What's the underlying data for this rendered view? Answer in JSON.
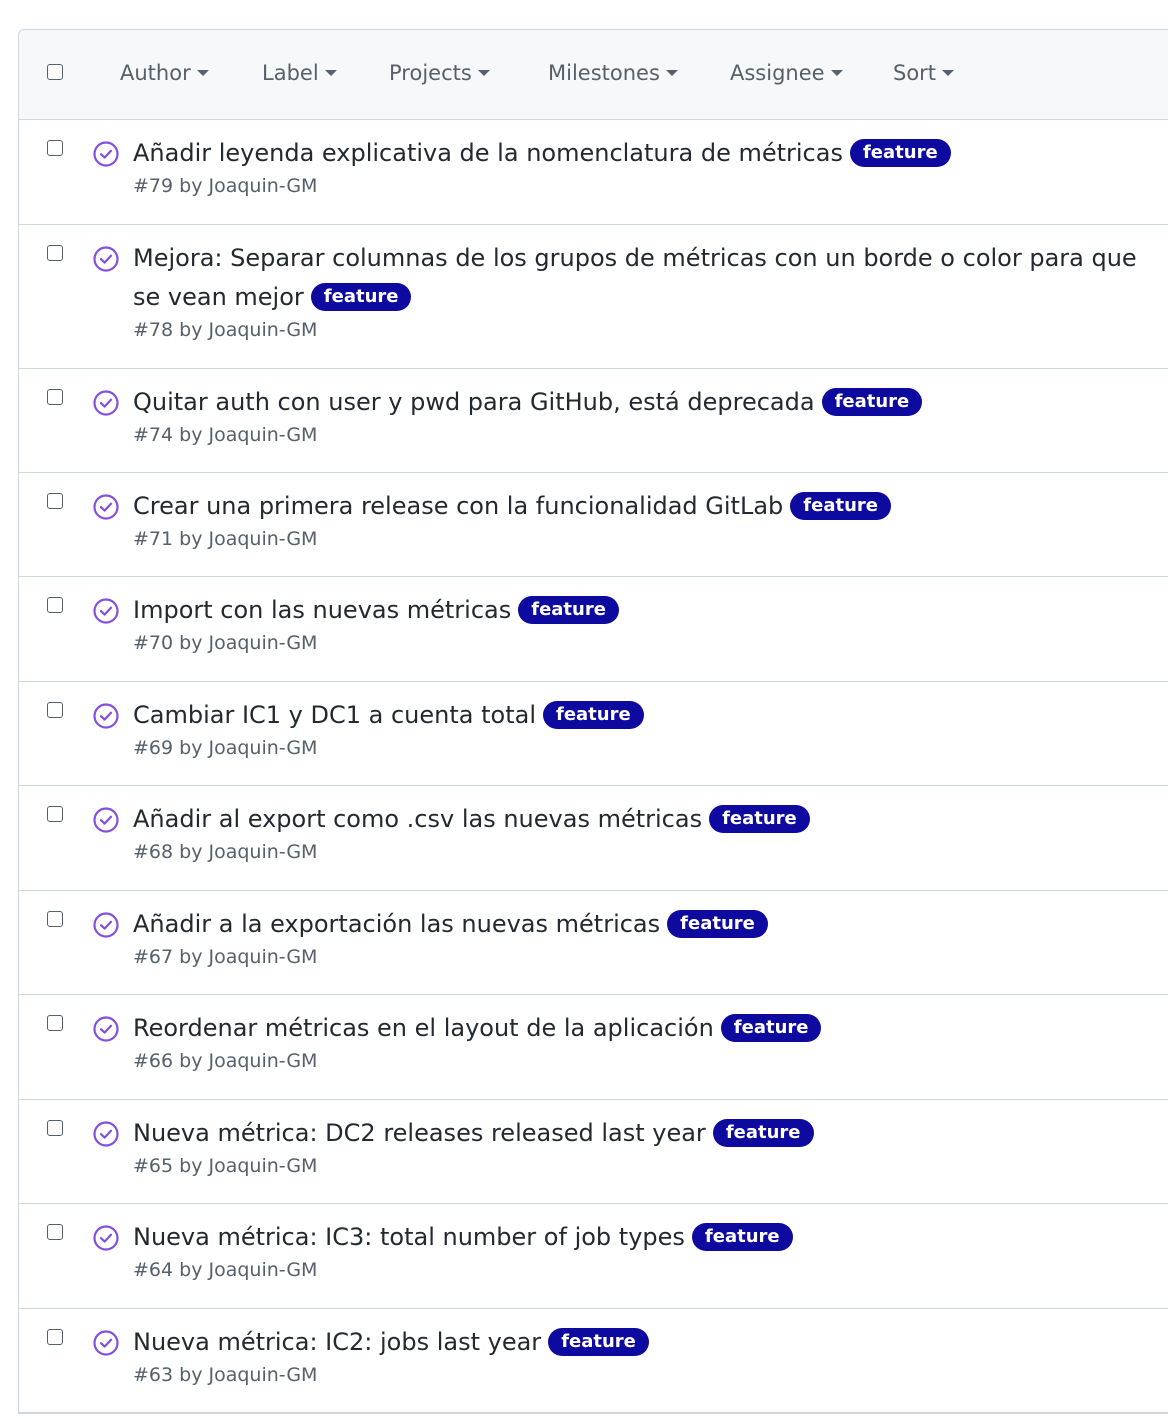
{
  "filters": {
    "author": "Author",
    "label": "Label",
    "projects": "Projects",
    "milestones": "Milestones",
    "assignee": "Assignee",
    "sort": "Sort"
  },
  "colors": {
    "badge_bg": "#0e0aa0",
    "closed_icon": "#8250df"
  },
  "issues": [
    {
      "title": "Añadir leyenda explicativa de la nomenclatura de métricas",
      "label": "feature",
      "meta": "#79 by Joaquin-GM",
      "status_icon": "closed-issue-icon"
    },
    {
      "title": "Mejora: Separar columnas de los grupos de métricas con un borde o color para que se vean mejor",
      "label": "feature",
      "meta": "#78 by Joaquin-GM",
      "status_icon": "closed-issue-icon"
    },
    {
      "title": "Quitar auth con user y pwd para GitHub, está deprecada",
      "label": "feature",
      "meta": "#74 by Joaquin-GM",
      "status_icon": "closed-issue-icon"
    },
    {
      "title": "Crear una primera release con la funcionalidad GitLab",
      "label": "feature",
      "meta": "#71 by Joaquin-GM",
      "status_icon": "closed-issue-icon"
    },
    {
      "title": "Import con las nuevas métricas",
      "label": "feature",
      "meta": "#70 by Joaquin-GM",
      "status_icon": "closed-issue-icon"
    },
    {
      "title": "Cambiar IC1 y DC1 a cuenta total",
      "label": "feature",
      "meta": "#69 by Joaquin-GM",
      "status_icon": "closed-issue-icon"
    },
    {
      "title": "Añadir al export como .csv las nuevas métricas",
      "label": "feature",
      "meta": "#68 by Joaquin-GM",
      "status_icon": "closed-issue-icon"
    },
    {
      "title": "Añadir a la exportación las nuevas métricas",
      "label": "feature",
      "meta": "#67 by Joaquin-GM",
      "status_icon": "closed-issue-icon"
    },
    {
      "title": "Reordenar métricas en el layout de la aplicación",
      "label": "feature",
      "meta": "#66 by Joaquin-GM",
      "status_icon": "closed-issue-icon"
    },
    {
      "title": "Nueva métrica: DC2 releases released last year",
      "label": "feature",
      "meta": "#65 by Joaquin-GM",
      "status_icon": "closed-issue-icon"
    },
    {
      "title": "Nueva métrica: IC3: total number of job types",
      "label": "feature",
      "meta": "#64 by Joaquin-GM",
      "status_icon": "closed-issue-icon"
    },
    {
      "title": "Nueva métrica: IC2: jobs last year",
      "label": "feature",
      "meta": "#63 by Joaquin-GM",
      "status_icon": "closed-issue-icon"
    }
  ]
}
